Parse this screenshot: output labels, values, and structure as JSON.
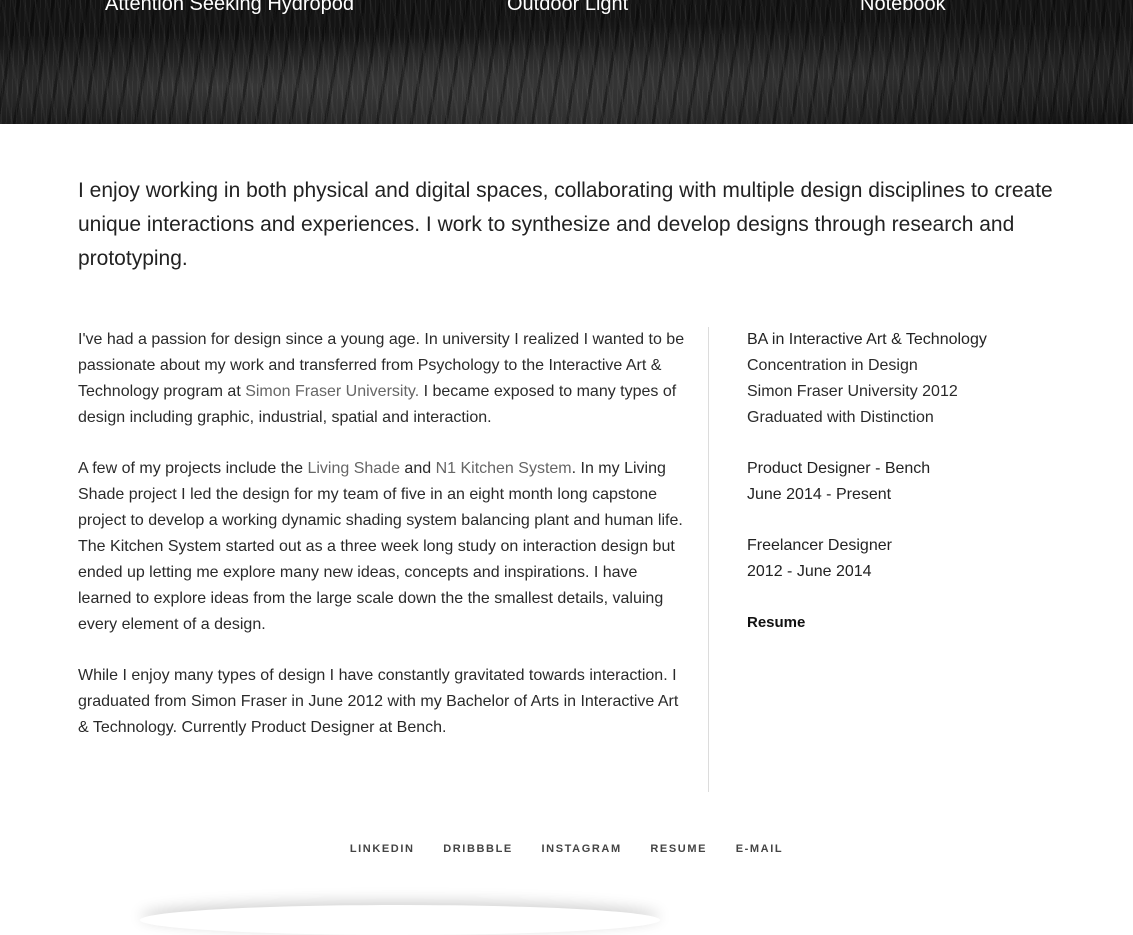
{
  "hero": {
    "projects": [
      {
        "label": "Attention Seeking Hydropod"
      },
      {
        "label": "Outdoor Light"
      },
      {
        "label": "Notebook"
      }
    ]
  },
  "intro": {
    "text": "I enjoy working in both physical and digital spaces, collaborating with multiple design disciplines to create unique interactions and experiences. I work to synthesize and develop designs through research and prototyping."
  },
  "bio": {
    "p1_before": "I've had a passion for design since a young age. In university I realized I wanted to be passionate about my work and transferred from Psychology to the Interactive Art & Technology program at ",
    "p1_link": "Simon Fraser University.",
    "p1_after": " I became exposed to many types of design including graphic, industrial, spatial and interaction.",
    "p2_before": "A few of my projects include the ",
    "p2_link1": "Living Shade",
    "p2_mid": " and ",
    "p2_link2": "N1 Kitchen System",
    "p2_after": ". In my Living Shade project I led the design for my team of five in an eight month long capstone project to develop a working dynamic shading system balancing plant and human life. The Kitchen System started out as a three week long study on interaction design but ended up letting me explore many new ideas, concepts and inspirations. I have learned to explore ideas from the large scale down the the smallest details, valuing every element of a design.",
    "p3": "While I enjoy many types of design I have constantly gravitated towards interaction. I graduated from Simon Fraser in June 2012 with my Bachelor of Arts in Interactive Art & Technology. Currently Product Designer at Bench."
  },
  "sidebar": {
    "education": {
      "degree": "BA in Interactive Art & Technology",
      "concentration": "Concentration in Design",
      "school": "Simon Fraser University 2012",
      "honors": "Graduated with Distinction"
    },
    "job1": {
      "title": "Product Designer - Bench",
      "dates": "June 2014 - Present"
    },
    "job2": {
      "title": "Freelancer Designer",
      "dates": "2012 - June 2014"
    },
    "resume_label": "Resume"
  },
  "footer": {
    "links": [
      "LINKEDIN",
      "DRIBBBLE",
      "INSTAGRAM",
      "RESUME",
      "E-MAIL"
    ]
  }
}
